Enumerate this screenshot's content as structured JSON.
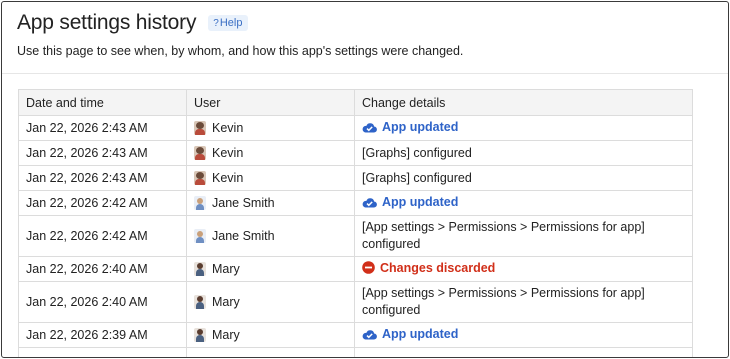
{
  "page": {
    "title": "App settings history",
    "help_label": "Help",
    "description": "Use this page to see when, by whom, and how this app's settings were changed."
  },
  "table": {
    "headers": [
      "Date and time",
      "User",
      "Change details"
    ],
    "rows": [
      {
        "datetime": "Jan 22, 2026 2:43 AM",
        "user": "Kevin",
        "detail": "App updated",
        "kind": "status-updated"
      },
      {
        "datetime": "Jan 22, 2026 2:43 AM",
        "user": "Kevin",
        "detail": "[Graphs] configured",
        "kind": "text"
      },
      {
        "datetime": "Jan 22, 2026 2:43 AM",
        "user": "Kevin",
        "detail": "[Graphs] configured",
        "kind": "text"
      },
      {
        "datetime": "Jan 22, 2026 2:42 AM",
        "user": "Jane Smith",
        "detail": "App updated",
        "kind": "status-updated"
      },
      {
        "datetime": "Jan 22, 2026 2:42 AM",
        "user": "Jane Smith",
        "detail": "[App settings > Permissions > Permissions for app] configured",
        "kind": "text"
      },
      {
        "datetime": "Jan 22, 2026 2:40 AM",
        "user": "Mary",
        "detail": "Changes discarded",
        "kind": "status-discarded"
      },
      {
        "datetime": "Jan 22, 2026 2:40 AM",
        "user": "Mary",
        "detail": "[App settings > Permissions > Permissions for app] configured",
        "kind": "text"
      },
      {
        "datetime": "Jan 22, 2026 2:39 AM",
        "user": "Mary",
        "detail": "App updated",
        "kind": "status-updated"
      }
    ]
  },
  "icons": {
    "help": "question-icon",
    "updated": "cloud-check-icon",
    "discarded": "minus-circle-icon"
  },
  "colors": {
    "link_blue": "#2e63c8",
    "error_red": "#d12f19",
    "help_bg": "#e9f1fb"
  }
}
